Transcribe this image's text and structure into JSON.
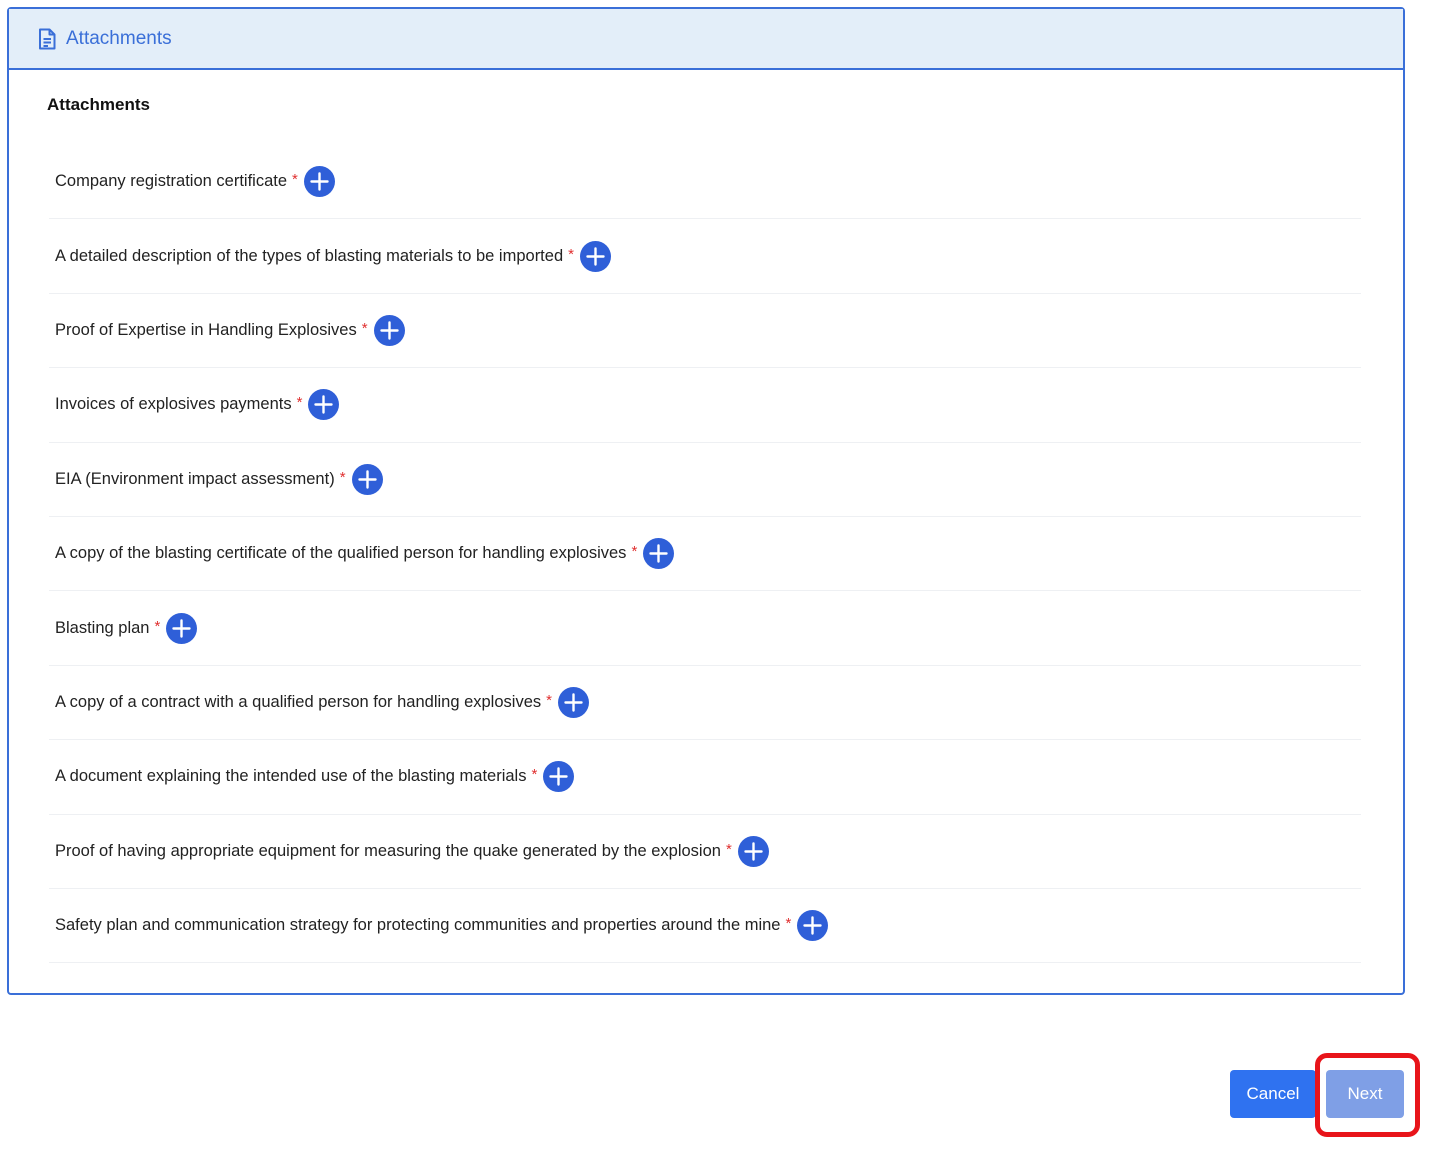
{
  "panel": {
    "header_title": "Attachments",
    "header_icon": "document-icon",
    "section_title": "Attachments"
  },
  "attachments": [
    {
      "label": "Company registration certificate",
      "required": "*"
    },
    {
      "label": "A detailed description of the types of blasting materials to be imported",
      "required": "*"
    },
    {
      "label": "Proof of Expertise in Handling Explosives",
      "required": "*"
    },
    {
      "label": "Invoices of explosives payments",
      "required": "*"
    },
    {
      "label": "EIA (Environment impact assessment)",
      "required": "*"
    },
    {
      "label": "A copy of the blasting certificate of the qualified person for handling explosives",
      "required": "*"
    },
    {
      "label": "Blasting plan",
      "required": "*"
    },
    {
      "label": "A copy of a contract with a qualified person for handling explosives",
      "required": "*"
    },
    {
      "label": "A document explaining the intended use of the blasting materials",
      "required": "*"
    },
    {
      "label": "Proof of having appropriate equipment for measuring the quake generated by the explosion",
      "required": "*"
    },
    {
      "label": "Safety plan and communication strategy for protecting communities and properties around the mine",
      "required": "*"
    }
  ],
  "add_icon": "plus-circle-icon",
  "buttons": {
    "cancel_label": "Cancel",
    "next_label": "Next"
  },
  "colors": {
    "accent": "#3a6fd8",
    "add_button": "#2f5fd8",
    "required": "#e03030",
    "highlight": "#e8141a"
  }
}
